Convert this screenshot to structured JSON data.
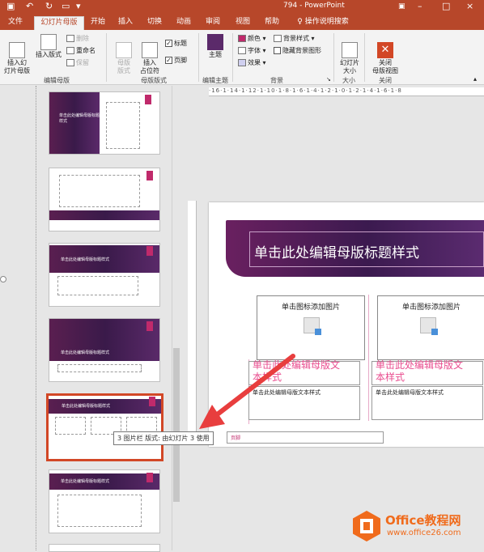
{
  "titlebar": {
    "doc": "794",
    "dash": "-",
    "app": "PowerPoint"
  },
  "tabs": [
    "文件",
    "幻灯片母版",
    "开始",
    "插入",
    "切换",
    "动画",
    "审阅",
    "视图",
    "帮助",
    "操作说明搜索"
  ],
  "ribbon": {
    "insert_slide_master": "插入幻\n灯片母版",
    "insert_layout": "插入版式",
    "delete": "删除",
    "rename": "重命名",
    "preserve": "保留",
    "group_edit_master": "编辑母版",
    "master_layout": "母版\n版式",
    "insert_placeholder": "插入\n占位符",
    "title_cb": "标题",
    "footer_cb": "页脚",
    "group_master_layout": "母版版式",
    "theme": "主题",
    "group_edit_theme": "编辑主题",
    "colors": "颜色",
    "fonts": "字体",
    "effects": "效果",
    "bg_styles": "背景样式",
    "hide_bg": "隐藏背景图形",
    "group_background": "背景",
    "slide_size": "幻灯片\n大小",
    "group_size": "大小",
    "close_master": "关闭\n母版视图",
    "group_close": "关闭"
  },
  "thumbs": {
    "t1": "单击此处编辑母版标题样式",
    "t3": "单击此处编辑母版标题样式",
    "t4": "单击此处编辑母版标题样式",
    "t5": "单击此处编辑母版标题样式",
    "t6": "单击此处编辑母版标题样式"
  },
  "tooltip": "3 图片栏 版式: 由幻灯片 3 使用",
  "ruler": "·16·1·14·1·12·1·10·1·8·1·6·1·4·1·2·1·0·1·2·1·4·1·6·1·8",
  "main": {
    "title": "单击此处编辑母版标题样式",
    "pic1": "单击图标添加图片",
    "pic2": "单击图标添加图片",
    "cap1": "单击此处编辑母版文\n本样式",
    "cap2": "单击此处编辑母版文\n本样式",
    "txt1": "单击此处编辑母版文本样式",
    "txt2": "单击此处编辑母版文本样式",
    "footer": "页脚"
  },
  "brand": {
    "name": "Office教程网",
    "url": "www.office26.com"
  }
}
